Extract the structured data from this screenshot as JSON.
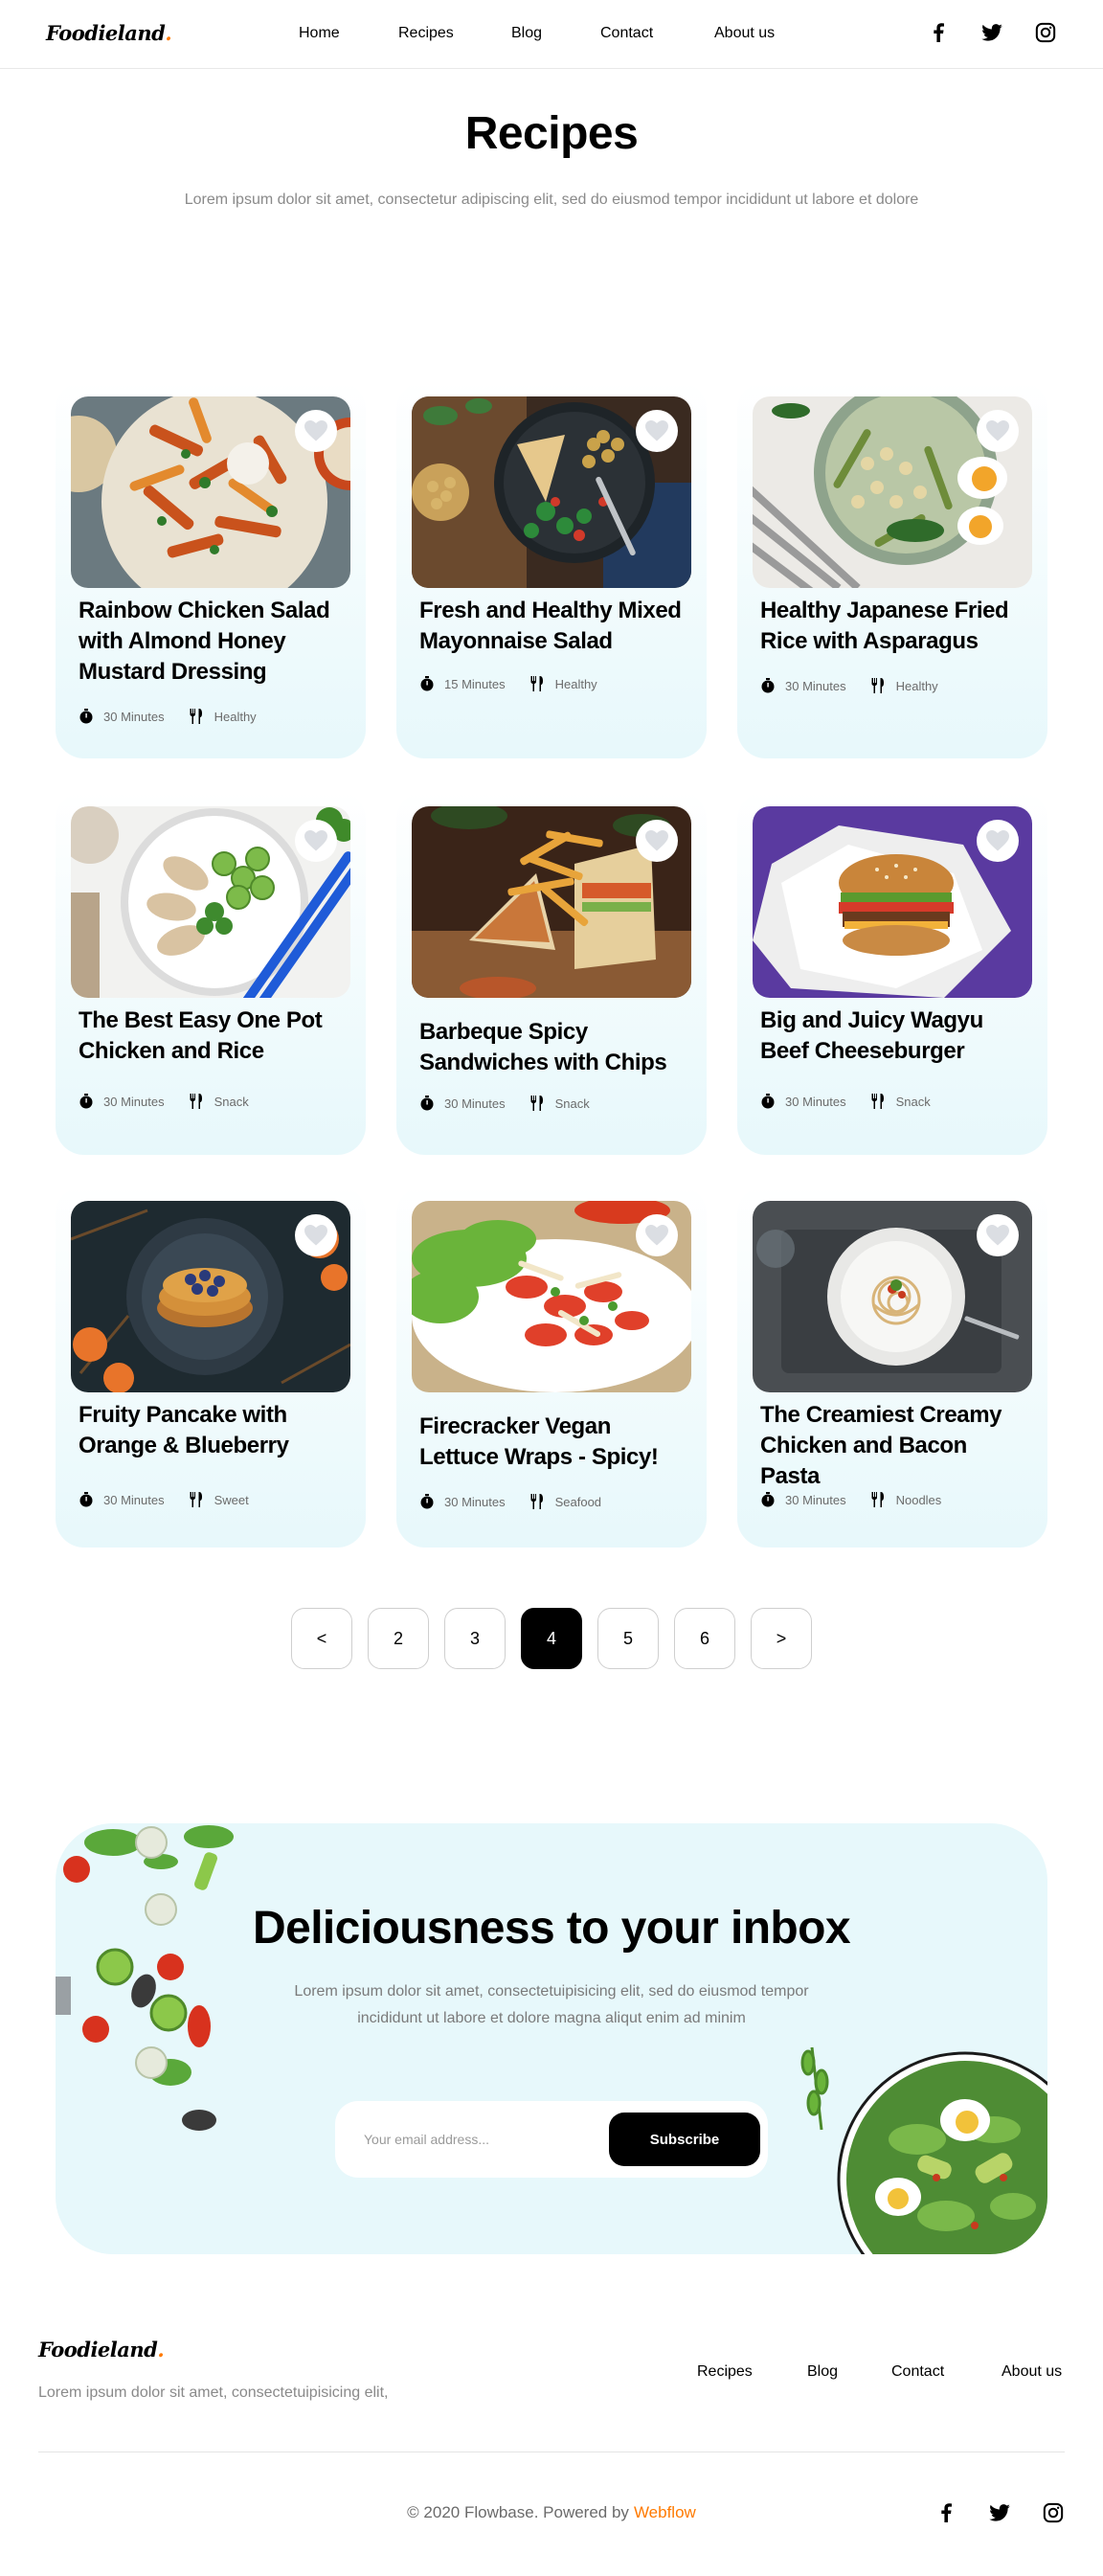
{
  "brand": {
    "logo": "Foodieland",
    "logo_dot": ".",
    "accent": "#ff7a00",
    "card_bg": "#e7f8fb"
  },
  "nav": {
    "items": [
      "Home",
      "Recipes",
      "Blog",
      "Contact",
      "About us"
    ]
  },
  "social": [
    "facebook-icon",
    "twitter-icon",
    "instagram-icon"
  ],
  "page": {
    "title": "Recipes",
    "subtitle": "Lorem ipsum dolor sit amet, consectetur adipiscing elit, sed do eiusmod tempor incididunt ut labore et dolore"
  },
  "recipes": [
    {
      "title": "Rainbow Chicken Salad with Almond Honey Mustard Dressing",
      "time": "30 Minutes",
      "category": "Healthy"
    },
    {
      "title": "Fresh and Healthy Mixed Mayonnaise Salad",
      "time": "15 Minutes",
      "category": "Healthy"
    },
    {
      "title": "Healthy Japanese Fried Rice with Asparagus",
      "time": "30 Minutes",
      "category": "Healthy"
    },
    {
      "title": "The Best Easy One Pot Chicken and Rice",
      "time": "30 Minutes",
      "category": "Snack"
    },
    {
      "title": "Barbeque Spicy Sandwiches with Chips",
      "time": "30 Minutes",
      "category": "Snack"
    },
    {
      "title": "Big and Juicy Wagyu Beef Cheeseburger",
      "time": "30 Minutes",
      "category": "Snack"
    },
    {
      "title": "Fruity Pancake with Orange & Blueberry",
      "time": "30 Minutes",
      "category": "Sweet"
    },
    {
      "title": "Firecracker Vegan Lettuce Wraps - Spicy!",
      "time": "30 Minutes",
      "category": "Seafood"
    },
    {
      "title": "The Creamiest Creamy Chicken and Bacon Pasta",
      "time": "30 Minutes",
      "category": "Noodles"
    }
  ],
  "pagination": {
    "prev": "<",
    "pages": [
      "2",
      "3",
      "4",
      "5",
      "6"
    ],
    "current": "4",
    "next": ">"
  },
  "newsletter": {
    "title": "Deliciousness to your inbox",
    "text": "Lorem ipsum dolor sit amet, consectetuipisicing elit, sed do eiusmod tempor incididunt ut labore et dolore magna aliqut enim ad minim",
    "placeholder": "Your email address...",
    "button": "Subscribe"
  },
  "footer": {
    "logo": "Foodieland",
    "description": "Lorem ipsum dolor sit amet, consectetuipisicing elit,",
    "nav": [
      "Recipes",
      "Blog",
      "Contact",
      "About us"
    ],
    "copyright": "© 2020 Flowbase. Powered by",
    "powered_by": "Webflow"
  }
}
